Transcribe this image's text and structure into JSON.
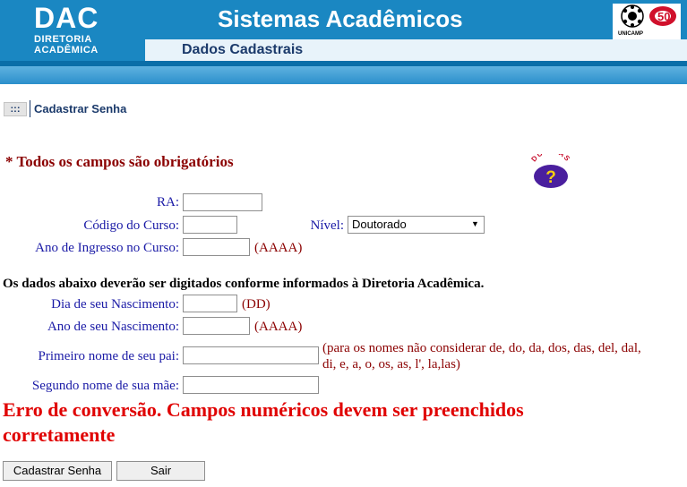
{
  "header": {
    "logo": "DAC",
    "logo_sub1": "DIRETORIA",
    "logo_sub2": "ACADÊMICA",
    "title": "Sistemas Acadêmicos",
    "subtitle": "Dados Cadastrais",
    "unicamp_label": "UNICAMP"
  },
  "breadcrumb": {
    "menu_glyph": ":::",
    "current": "Cadastrar Senha"
  },
  "notice": "* Todos os campos são obrigatórios",
  "help_icon": {
    "name": "duvidas-help-icon",
    "text": "DÚVIDAS",
    "glyph": "?"
  },
  "form": {
    "ra": {
      "label": "RA:",
      "value": ""
    },
    "codigo_curso": {
      "label": "Código do Curso:",
      "value": ""
    },
    "nivel": {
      "label": "Nível:",
      "selected": "Doutorado"
    },
    "ano_ingresso": {
      "label": "Ano de Ingresso no Curso:",
      "value": "",
      "hint": "(AAAA)"
    },
    "dados_note": "Os dados abaixo deverão ser digitados conforme informados à Diretoria Acadêmica.",
    "dia_nascimento": {
      "label": "Dia de seu Nascimento:",
      "value": "",
      "hint": "(DD)"
    },
    "ano_nascimento": {
      "label": "Ano de seu Nascimento:",
      "value": "",
      "hint": "(AAAA)"
    },
    "primeiro_nome_pai": {
      "label": "Primeiro nome de seu pai:",
      "value": "",
      "hint_line1": "(para os nomes não considerar de, do, da, dos, das, del, dal,",
      "hint_line2": "di, e, a, o, os, as, l', la,las)"
    },
    "segundo_nome_mae": {
      "label": "Segundo nome de sua mãe:",
      "value": ""
    }
  },
  "error": {
    "line1": "Erro de conversão. Campos numéricos devem ser preenchidos",
    "line2": "corretamente"
  },
  "buttons": {
    "cadastrar": "Cadastrar Senha",
    "sair": "Sair"
  },
  "colors": {
    "header_blue": "#1a87c2",
    "label_blue": "#1a1aa6",
    "hint_red": "#8b0000",
    "error_red": "#e00000"
  }
}
